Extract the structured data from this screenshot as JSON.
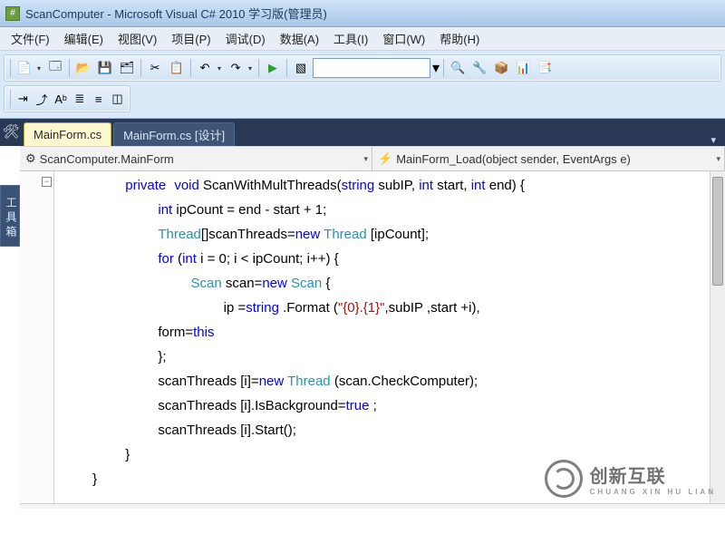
{
  "titlebar": {
    "app_icon": "VS",
    "text": "ScanComputer - Microsoft Visual C# 2010 学习版(管理员)"
  },
  "menu": {
    "file": "文件(F)",
    "edit": "编辑(E)",
    "view": "视图(V)",
    "project": "项目(P)",
    "debug": "调试(D)",
    "data": "数据(A)",
    "tools": "工具(I)",
    "window": "窗口(W)",
    "help": "帮助(H)"
  },
  "tabs": {
    "active": "MainForm.cs",
    "inactive": "MainForm.cs [设计]"
  },
  "sidetab": {
    "label": "工具箱"
  },
  "nav": {
    "left_icon": "⚙",
    "left": "ScanComputer.MainForm",
    "right_icon": "⚡",
    "right": "MainForm_Load(object sender, EventArgs e)"
  },
  "icons": {
    "new": "📄",
    "open": "📂",
    "save": "💾",
    "saveall": "🗂",
    "cut": "✂",
    "copy": "📋",
    "undo": "↶",
    "redo": "↷",
    "play": "▶",
    "props": "🗔",
    "find": "🔍",
    "comment": "📑",
    "break": "●",
    "step": "↘",
    "cfg1": "🔧",
    "cfg2": "📦",
    "cfg3": "📊",
    "box": "▧",
    "t1": "⇥",
    "t2": "⤴",
    "t3": "Aᵇ",
    "t4": "≣",
    "t5": "≡",
    "t6": "◫"
  },
  "code": {
    "l1a": "private",
    "l1b": "void",
    "l1c": " ScanWithMultThreads(",
    "l1d": "string",
    "l1e": " subIP, ",
    "l1f": "int",
    "l1g": " start, ",
    "l1h": "int",
    "l1i": " end) {",
    "l2a": "int",
    "l2b": " ipCount = end - start + 1;",
    "l3a": "Thread",
    "l3b": "[]scanThreads=",
    "l3c": "new",
    "l3d": " ",
    "l3e": "Thread",
    "l3f": " [ipCount];",
    "l4a": "for",
    "l4b": " (",
    "l4c": "int",
    "l4d": " i = 0; i < ipCount; i++) {",
    "l5a": "Scan",
    "l5b": " scan=",
    "l5c": "new",
    "l5d": " ",
    "l5e": "Scan",
    "l5f": " {",
    "l6a": "ip =",
    "l6b": "string",
    "l6c": " .Format (",
    "l6d": "\"{0}.{1}\"",
    "l6e": ",subIP ,start +i),",
    "l7a": "form=",
    "l7b": "this",
    "l8": "};",
    "l9a": "scanThreads [i]=",
    "l9b": "new",
    "l9c": " ",
    "l9d": "Thread",
    "l9e": " (scan.CheckComputer);",
    "l10a": "scanThreads [i].IsBackground=",
    "l10b": "true",
    "l10c": " ;",
    "l11": "scanThreads [i].Start();",
    "l12": "}",
    "l13": "}"
  },
  "watermark": {
    "main": "创新互联",
    "sub": "CHUANG XIN HU LIAN"
  }
}
